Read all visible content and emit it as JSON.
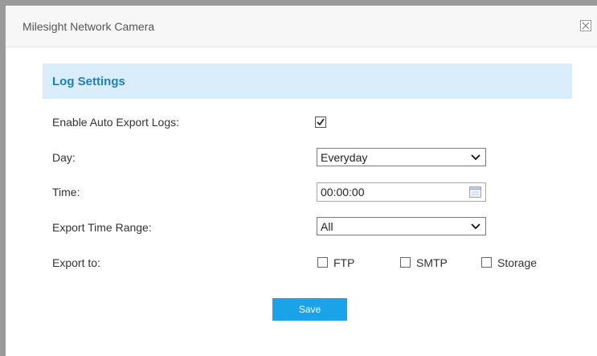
{
  "window": {
    "title": "Milesight Network Camera",
    "close_icon": "close-icon"
  },
  "section": {
    "title": "Log Settings"
  },
  "fields": {
    "auto_export": {
      "label": "Enable Auto Export Logs:",
      "checked": true
    },
    "day": {
      "label": "Day:",
      "value": "Everyday"
    },
    "time": {
      "label": "Time:",
      "value": "00:00:00",
      "icon": "calendar-icon"
    },
    "range": {
      "label": "Export Time Range:",
      "value": "All"
    },
    "export_to": {
      "label": "Export to:",
      "options": [
        {
          "label": "FTP",
          "checked": false
        },
        {
          "label": "SMTP",
          "checked": false
        },
        {
          "label": "Storage",
          "checked": false
        }
      ]
    }
  },
  "actions": {
    "save_label": "Save"
  },
  "colors": {
    "header_bg": "#d9eefa",
    "header_text": "#1c7fc5",
    "button_bg": "#1aa3e8"
  }
}
